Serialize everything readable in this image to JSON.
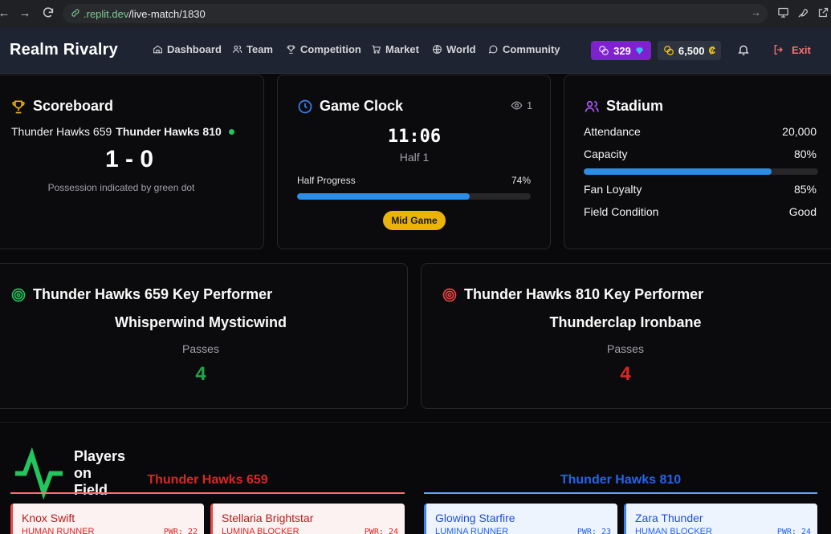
{
  "browser": {
    "url_host": ".replit.dev",
    "url_path": "/live-match/1830"
  },
  "header": {
    "brand": "Realm Rivalry",
    "nav": [
      {
        "label": "Dashboard",
        "icon": "home-icon"
      },
      {
        "label": "Team",
        "icon": "users-icon"
      },
      {
        "label": "Competition",
        "icon": "trophy-icon"
      },
      {
        "label": "Market",
        "icon": "cart-icon"
      },
      {
        "label": "World",
        "icon": "globe-icon"
      },
      {
        "label": "Community",
        "icon": "chat-icon"
      }
    ],
    "gems": "329",
    "coins": "6,500",
    "exit_label": "Exit"
  },
  "scoreboard": {
    "title": "Scoreboard",
    "home_team": "Thunder Hawks 659",
    "away_team": "Thunder Hawks 810",
    "score": "1 - 0",
    "note": "Possession indicated by green dot"
  },
  "game_clock": {
    "title": "Game Clock",
    "viewers": "1",
    "time": "11:06",
    "half": "Half 1",
    "progress_label": "Half Progress",
    "progress_text": "74%",
    "progress_value": 74,
    "phase_badge": "Mid Game"
  },
  "stadium": {
    "title": "Stadium",
    "attendance_label": "Attendance",
    "attendance": "20,000",
    "capacity_label": "Capacity",
    "capacity_text": "80%",
    "capacity_value": 80,
    "fan_loyalty_label": "Fan Loyalty",
    "fan_loyalty": "85%",
    "field_condition_label": "Field Condition",
    "field_condition": "Good"
  },
  "performers": [
    {
      "title": "Thunder Hawks 659 Key Performer",
      "name": "Whisperwind Mysticwind",
      "stat_label": "Passes",
      "stat_value": "4",
      "color": "#22a34a"
    },
    {
      "title": "Thunder Hawks 810 Key Performer",
      "name": "Thunderclap Ironbane",
      "stat_label": "Passes",
      "stat_value": "4",
      "color": "#dc2626"
    }
  ],
  "players_on_field": {
    "title": "Players on Field",
    "home": {
      "team": "Thunder Hawks 659",
      "color": "#dc2626",
      "players": [
        {
          "name": "Knox Swift",
          "role": "Human Runner",
          "power": "PWR: 22"
        },
        {
          "name": "Stellaria Brightstar",
          "role": "Lumina Blocker",
          "power": "PWR: 24"
        }
      ]
    },
    "away": {
      "team": "Thunder Hawks 810",
      "color": "#2563eb",
      "players": [
        {
          "name": "Glowing Starfire",
          "role": "Lumina Runner",
          "power": "PWR: 23"
        },
        {
          "name": "Zara Thunder",
          "role": "Human Blocker",
          "power": "PWR: 24"
        }
      ]
    }
  }
}
